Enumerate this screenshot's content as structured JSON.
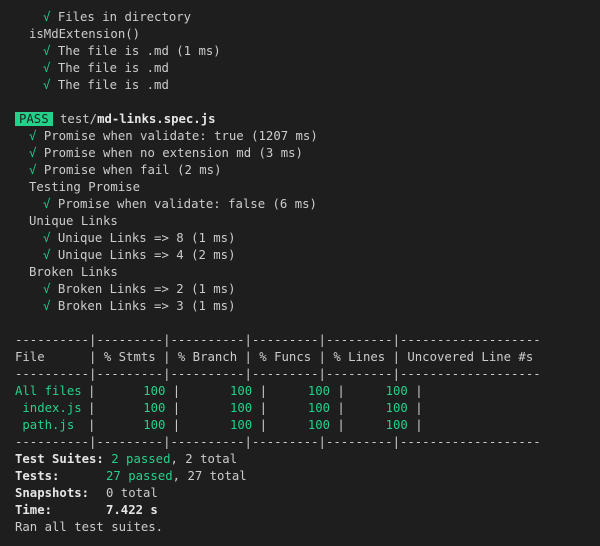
{
  "check_glyph": "√",
  "pre_tests": {
    "files_in_directory": "Files in directory",
    "group": "isMdExtension()",
    "items": [
      "The file is .md (1 ms)",
      "The file is .md",
      "The file is .md"
    ]
  },
  "suite": {
    "badge": "PASS",
    "path_prefix": "test/",
    "file": "md-links.spec.js",
    "tests": [
      "Promise when validate: true (1207 ms)",
      "Promise when no extension md (3 ms)",
      "Promise when fail (2 ms)"
    ],
    "groups": [
      {
        "name": "Testing Promise",
        "items": [
          "Promise when validate: false (6 ms)"
        ]
      },
      {
        "name": "Unique Links",
        "items": [
          "Unique Links => 8 (1 ms)",
          "Unique Links => 4 (2 ms)"
        ]
      },
      {
        "name": "Broken Links",
        "items": [
          "Broken Links => 2 (1 ms)",
          "Broken Links => 3 (1 ms)"
        ]
      }
    ]
  },
  "coverage": {
    "separator": "----------|---------|----------|---------|---------|-------------------",
    "header": "File      | % Stmts | % Branch | % Funcs | % Lines | Uncovered Line #s ",
    "rows": [
      {
        "file": "All files",
        "stmts": "100",
        "branch": "100",
        "funcs": "100",
        "lines": "100",
        "uncovered": ""
      },
      {
        "file": " index.js",
        "stmts": "100",
        "branch": "100",
        "funcs": "100",
        "lines": "100",
        "uncovered": ""
      },
      {
        "file": " path.js",
        "stmts": "100",
        "branch": "100",
        "funcs": "100",
        "lines": "100",
        "uncovered": ""
      }
    ]
  },
  "summary": {
    "suites_label": "Test Suites:",
    "suites_passed": "2 passed",
    "suites_total": ", 2 total",
    "tests_label": "Tests:",
    "tests_passed": "27 passed",
    "tests_total": ", 27 total",
    "snapshots_label": "Snapshots:",
    "snapshots_value": "0 total",
    "time_label": "Time:",
    "time_value": "7.422 s",
    "ran": "Ran all test suites."
  },
  "colors": {
    "background": "#1e1e1e",
    "text": "#cccccc",
    "success": "#23d18b",
    "time": "#f5f543"
  }
}
